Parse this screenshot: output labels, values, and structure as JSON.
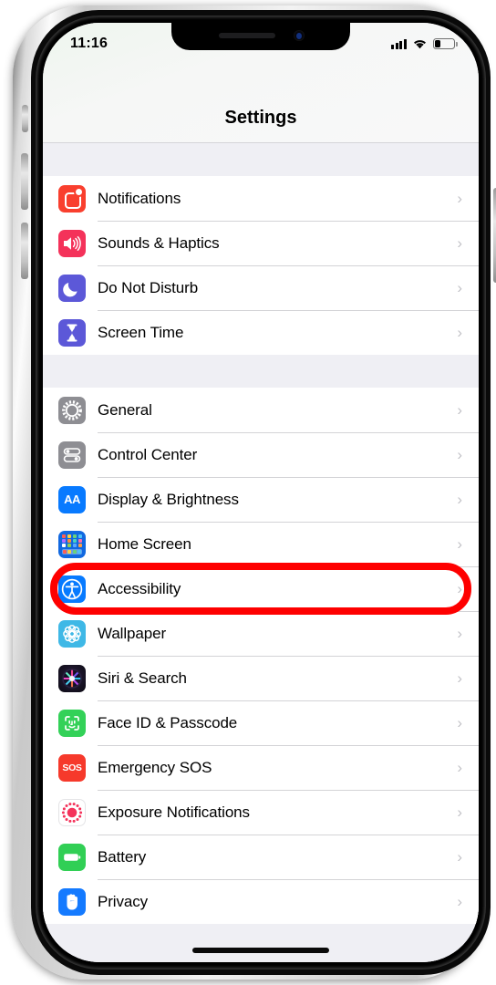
{
  "device": {
    "buttons": {
      "mute_switch": "Ring/Silent switch",
      "volume_up": "Volume up",
      "volume_down": "Volume down",
      "power": "Side button"
    }
  },
  "status_bar": {
    "time": "11:16",
    "signal_icon": "cellular-signal-icon",
    "signal_bars": 4,
    "wifi_icon": "wifi-icon",
    "battery_icon": "battery-icon",
    "battery_level_percent": 25
  },
  "nav": {
    "title": "Settings"
  },
  "groups": [
    {
      "id": "group-1",
      "rows": [
        {
          "label": "Notifications",
          "icon": "notifications-icon",
          "icon_class": "ic-notifications",
          "chevron": "›"
        },
        {
          "label": "Sounds & Haptics",
          "icon": "sounds-haptics-icon",
          "icon_class": "ic-sounds",
          "chevron": "›"
        },
        {
          "label": "Do Not Disturb",
          "icon": "do-not-disturb-icon",
          "icon_class": "ic-dnd",
          "chevron": "›"
        },
        {
          "label": "Screen Time",
          "icon": "screen-time-icon",
          "icon_class": "ic-screentime",
          "chevron": "›"
        }
      ]
    },
    {
      "id": "group-2",
      "rows": [
        {
          "label": "General",
          "icon": "general-gear-icon",
          "icon_class": "ic-general",
          "chevron": "›"
        },
        {
          "label": "Control Center",
          "icon": "control-center-icon",
          "icon_class": "ic-controlcenter",
          "chevron": "›"
        },
        {
          "label": "Display & Brightness",
          "icon": "display-brightness-icon",
          "icon_class": "ic-display",
          "chevron": "›"
        },
        {
          "label": "Home Screen",
          "icon": "home-screen-icon",
          "icon_class": "ic-homescreen",
          "chevron": "›"
        },
        {
          "label": "Accessibility",
          "icon": "accessibility-icon",
          "icon_class": "ic-accessibility",
          "chevron": "›",
          "highlighted": true
        },
        {
          "label": "Wallpaper",
          "icon": "wallpaper-icon",
          "icon_class": "ic-wallpaper",
          "chevron": "›"
        },
        {
          "label": "Siri & Search",
          "icon": "siri-search-icon",
          "icon_class": "ic-siri",
          "chevron": "›"
        },
        {
          "label": "Face ID & Passcode",
          "icon": "face-id-icon",
          "icon_class": "ic-faceid",
          "chevron": "›"
        },
        {
          "label": "Emergency SOS",
          "icon": "emergency-sos-icon",
          "icon_class": "ic-sos",
          "chevron": "›",
          "glyph": "SOS"
        },
        {
          "label": "Exposure Notifications",
          "icon": "exposure-notifications-icon",
          "icon_class": "ic-exposure",
          "chevron": "›"
        },
        {
          "label": "Battery",
          "icon": "battery-settings-icon",
          "icon_class": "ic-battery",
          "chevron": "›"
        },
        {
          "label": "Privacy",
          "icon": "privacy-hand-icon",
          "icon_class": "ic-privacy",
          "chevron": "›"
        }
      ]
    }
  ],
  "annotation": {
    "type": "highlight-ellipse",
    "target": "Accessibility",
    "color": "#fe0000"
  },
  "display_icon_glyph": "AA",
  "home_indicator": "home-indicator"
}
